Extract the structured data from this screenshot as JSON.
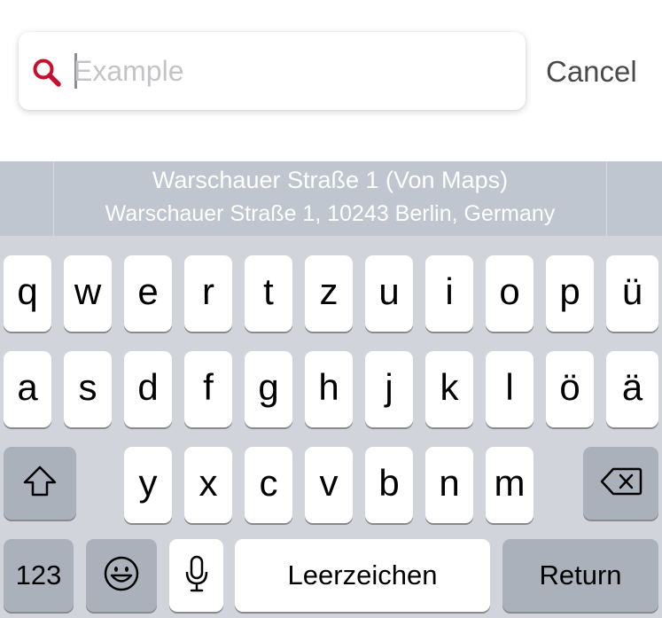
{
  "search": {
    "placeholder": "Example",
    "value": ""
  },
  "cancel_label": "Cancel",
  "suggestion": {
    "title": "Warschauer Straße 1 (Von Maps)",
    "subtitle": "Warschauer Straße 1, 10243 Berlin, Germany"
  },
  "keyboard": {
    "row1": [
      "q",
      "w",
      "e",
      "r",
      "t",
      "z",
      "u",
      "i",
      "o",
      "p",
      "ü"
    ],
    "row2": [
      "a",
      "s",
      "d",
      "f",
      "g",
      "h",
      "j",
      "k",
      "l",
      "ö",
      "ä"
    ],
    "row3": [
      "y",
      "x",
      "c",
      "v",
      "b",
      "n",
      "m"
    ],
    "numbers_label": "123",
    "space_label": "Leerzeichen",
    "return_label": "Return",
    "icons": {
      "shift": "shift-icon",
      "delete": "delete-icon",
      "emoji": "emoji-icon",
      "mic": "microphone-icon"
    }
  },
  "colors": {
    "accent": "#c8102e",
    "suggestion_bar": "#bfc6cf",
    "keyboard_bg": "#d1d5db",
    "function_key": "#abb1ba",
    "key_shadow": "#898a8d"
  }
}
